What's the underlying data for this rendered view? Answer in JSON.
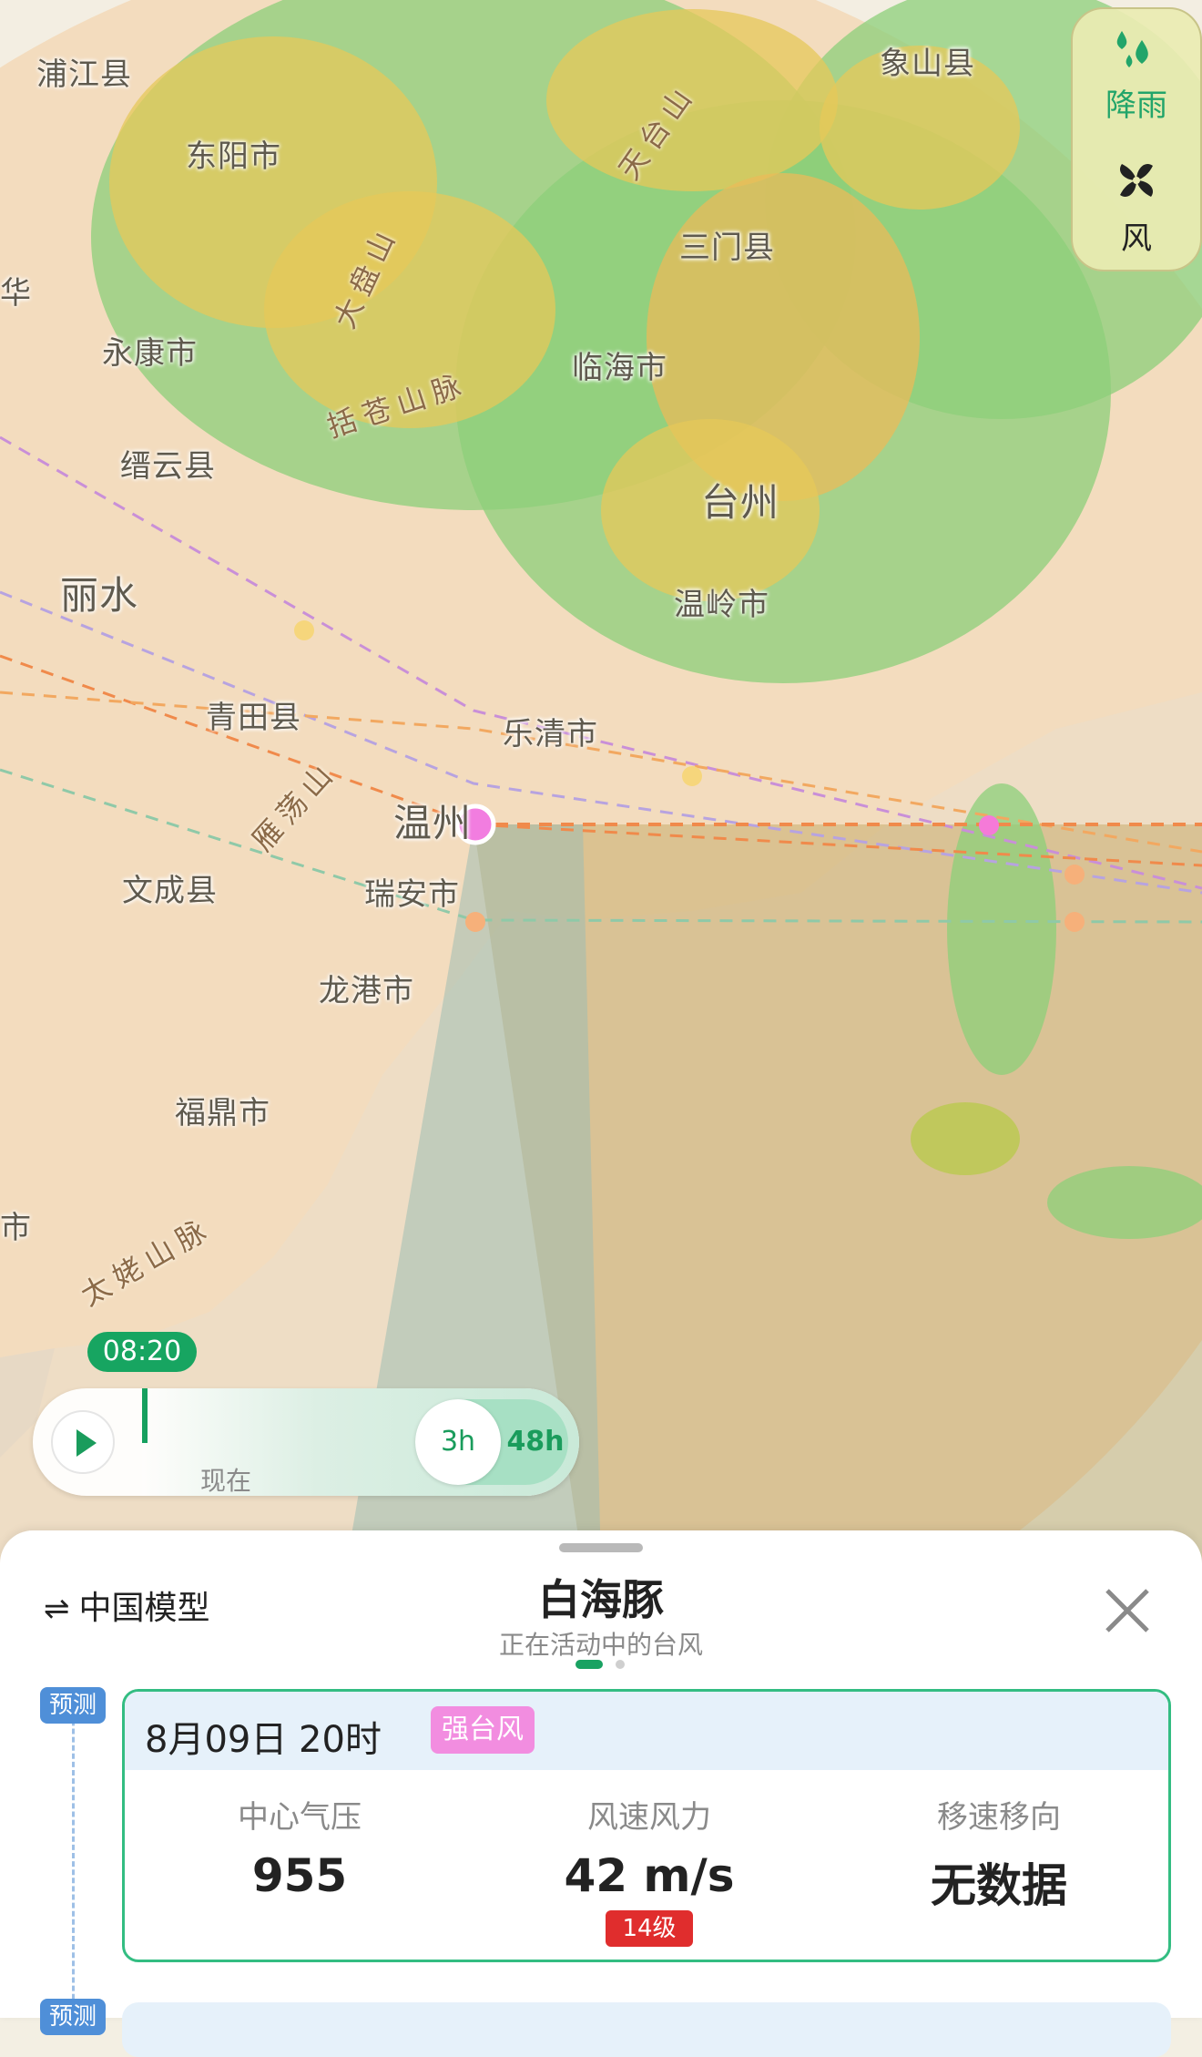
{
  "map": {
    "places": [
      {
        "name": "浦江县"
      },
      {
        "name": "东阳市"
      },
      {
        "name": "象山县"
      },
      {
        "name": "三门县"
      },
      {
        "name": "永康市"
      },
      {
        "name": "临海市"
      },
      {
        "name": "缙云县"
      },
      {
        "name": "台州"
      },
      {
        "name": "丽水"
      },
      {
        "name": "温岭市"
      },
      {
        "name": "青田县"
      },
      {
        "name": "乐清市"
      },
      {
        "name": "温州"
      },
      {
        "name": "文成县"
      },
      {
        "name": "瑞安市"
      },
      {
        "name": "龙港市"
      },
      {
        "name": "福鼎市"
      },
      {
        "name": "华"
      },
      {
        "name": "市"
      }
    ],
    "ranges": [
      {
        "name": "天台山"
      },
      {
        "name": "大盘山"
      },
      {
        "name": "括苍山脉"
      },
      {
        "name": "雁荡山"
      },
      {
        "name": "太姥山脉"
      }
    ]
  },
  "layers": {
    "rain": {
      "label": "降雨",
      "icon": "raindrops-icon",
      "active": true,
      "color": "#22a56a"
    },
    "wind": {
      "label": "风",
      "icon": "fan-icon",
      "active": false
    }
  },
  "timeline": {
    "current_time": "08:20",
    "now_label": "现在",
    "range_options": [
      "3h",
      "48h"
    ],
    "selected_range": "3h",
    "play_icon": "play-icon"
  },
  "panel": {
    "model_label": "中国模型",
    "model_icon": "swap-arrows-icon",
    "typhoon_name": "白海豚",
    "typhoon_status": "正在活动中的台风",
    "close_icon": "close-icon",
    "pages": 2,
    "current_page": 1,
    "forecast_tag": "预测",
    "forecast": {
      "datetime": "8月09日 20时",
      "level": "强台风",
      "level_color": "#f28de0",
      "pressure_label": "中心气压",
      "pressure_value": "955",
      "wind_label": "风速风力",
      "wind_value": "42 m/s",
      "wind_grade": "14级",
      "move_label": "移速移向",
      "move_value": "无数据"
    },
    "next_tag": "预测"
  }
}
